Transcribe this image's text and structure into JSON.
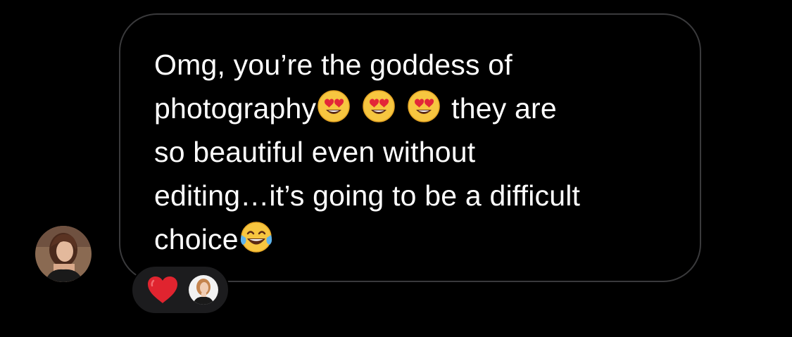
{
  "sender": {
    "avatar_icon": "user-avatar-icon"
  },
  "message": {
    "line1": "Omg, you’re the goddess of",
    "line2_text_before": "photography",
    "line2_emojis": [
      "heart-eyes-emoji",
      "heart-eyes-emoji",
      "heart-eyes-emoji"
    ],
    "line2_text_after": "they are",
    "line3": "so beautiful even without",
    "line4": "editing…it’s going to be a difficult",
    "line5_text": "choice",
    "line5_emoji": "tears-of-joy-emoji"
  },
  "reactions": {
    "emoji": "red-heart-icon",
    "reactor_avatar_icon": "reactor-avatar-icon"
  },
  "colors": {
    "background": "#000000",
    "bubble_border": "#3a3a3c",
    "reaction_pill": "#1c1c1e",
    "text": "#ffffff",
    "heart": "#e0242f"
  }
}
